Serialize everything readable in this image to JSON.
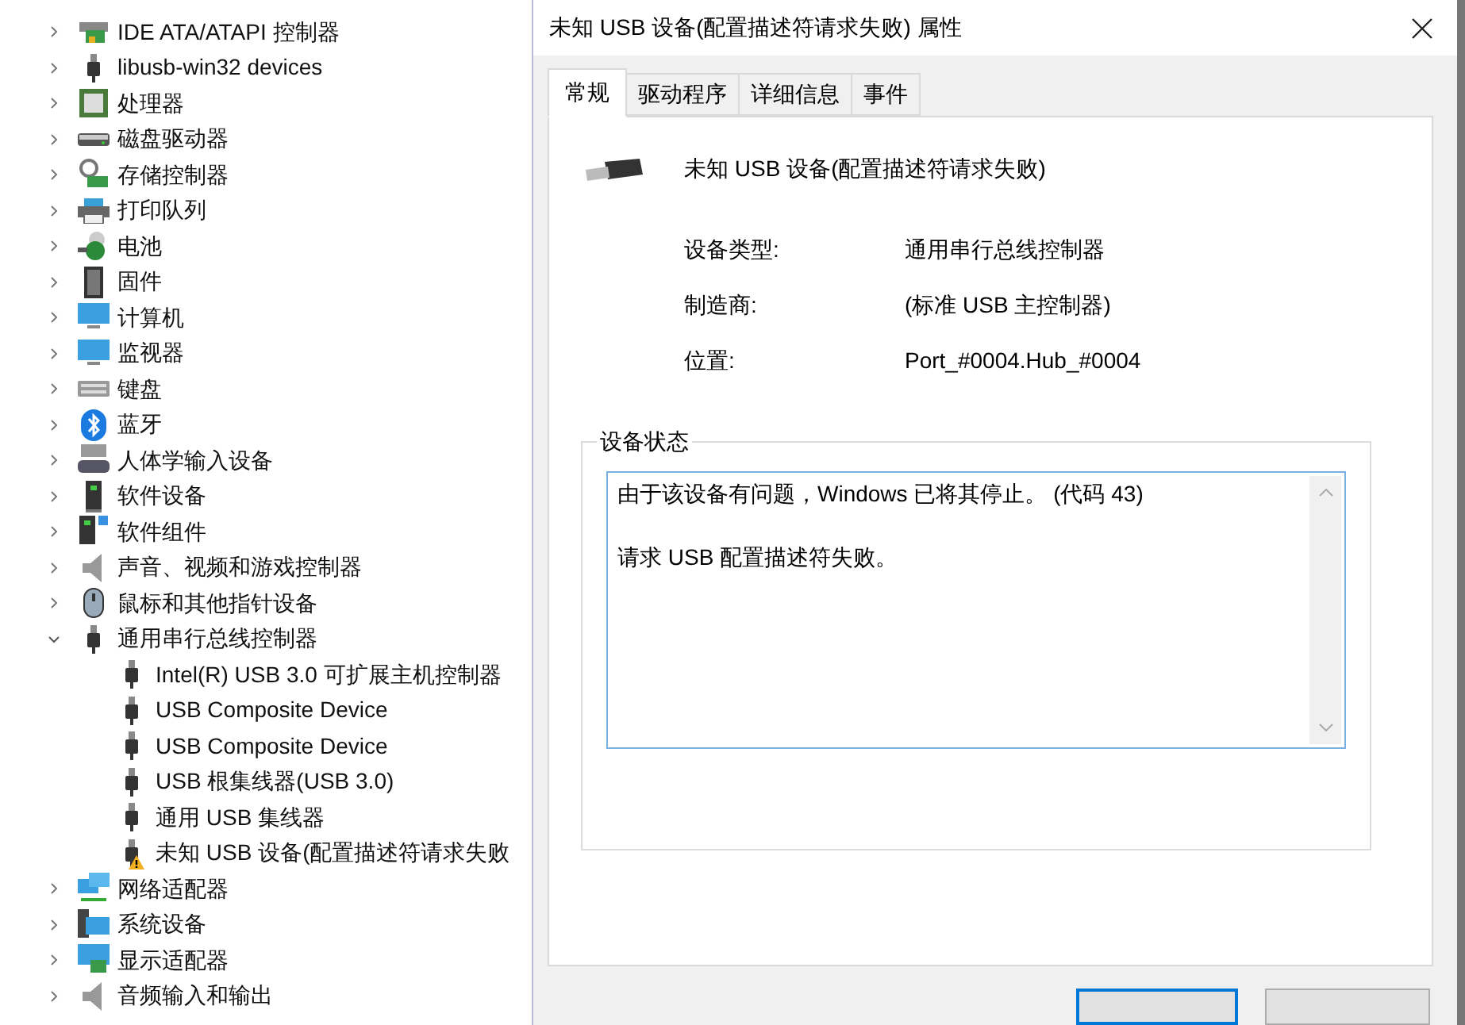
{
  "device_tree": {
    "items": [
      {
        "label": "IDE ATA/ATAPI 控制器",
        "expanded": false
      },
      {
        "label": "libusb-win32 devices",
        "expanded": false
      },
      {
        "label": "处理器",
        "expanded": false
      },
      {
        "label": "磁盘驱动器",
        "expanded": false
      },
      {
        "label": "存储控制器",
        "expanded": false
      },
      {
        "label": "打印队列",
        "expanded": false
      },
      {
        "label": "电池",
        "expanded": false
      },
      {
        "label": "固件",
        "expanded": false
      },
      {
        "label": "计算机",
        "expanded": false
      },
      {
        "label": "监视器",
        "expanded": false
      },
      {
        "label": "键盘",
        "expanded": false
      },
      {
        "label": "蓝牙",
        "expanded": false
      },
      {
        "label": "人体学输入设备",
        "expanded": false
      },
      {
        "label": "软件设备",
        "expanded": false
      },
      {
        "label": "软件组件",
        "expanded": false
      },
      {
        "label": "声音、视频和游戏控制器",
        "expanded": false
      },
      {
        "label": "鼠标和其他指针设备",
        "expanded": false
      },
      {
        "label": "通用串行总线控制器",
        "expanded": true,
        "children": [
          {
            "label": "Intel(R) USB 3.0 可扩展主机控制器",
            "warning": false
          },
          {
            "label": "USB Composite Device",
            "warning": false
          },
          {
            "label": "USB Composite Device",
            "warning": false
          },
          {
            "label": "USB 根集线器(USB 3.0)",
            "warning": false
          },
          {
            "label": "通用 USB 集线器",
            "warning": false
          },
          {
            "label": "未知 USB 设备(配置描述符请求失败",
            "warning": true
          }
        ]
      },
      {
        "label": "网络适配器",
        "expanded": false
      },
      {
        "label": "系统设备",
        "expanded": false
      },
      {
        "label": "显示适配器",
        "expanded": false
      },
      {
        "label": "音频输入和输出",
        "expanded": false
      }
    ]
  },
  "dialog": {
    "title": "未知 USB 设备(配置描述符请求失败) 属性",
    "tabs": [
      {
        "label": "常规",
        "selected": true
      },
      {
        "label": "驱动程序",
        "selected": false
      },
      {
        "label": "详细信息",
        "selected": false
      },
      {
        "label": "事件",
        "selected": false
      }
    ],
    "device_name": "未知 USB 设备(配置描述符请求失败)",
    "properties": [
      {
        "label": "设备类型:",
        "value": "通用串行总线控制器"
      },
      {
        "label": "制造商:",
        "value": "(标准 USB 主控制器)"
      },
      {
        "label": "位置:",
        "value": "Port_#0004.Hub_#0004"
      }
    ],
    "status_group": {
      "title": "设备状态",
      "lines": [
        "由于该设备有问题，Windows 已将其停止。 (代码 43)",
        "请求 USB 配置描述符失败。"
      ]
    }
  }
}
